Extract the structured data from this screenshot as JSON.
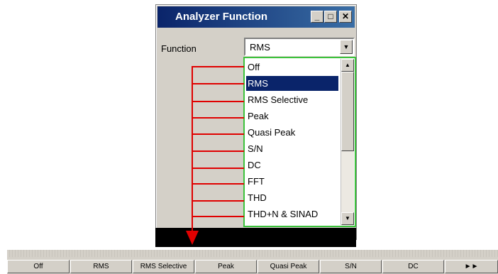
{
  "dialog": {
    "title": "Analyzer Function",
    "title_buttons": {
      "minimize": "_",
      "maximize": "□",
      "close": "✕"
    },
    "function_label": "Function",
    "function_value": "RMS"
  },
  "dropdown": {
    "items": [
      "Off",
      "RMS",
      "RMS Selective",
      "Peak",
      "Quasi Peak",
      "S/N",
      "DC",
      "FFT",
      "THD",
      "THD+N & SINAD"
    ],
    "selected_index": 1,
    "scroll_up": "▲",
    "scroll_down": "▼"
  },
  "softkeys": [
    "Off",
    "RMS",
    "RMS Selective",
    "Peak",
    "Quasi Peak",
    "S/N",
    "DC",
    "►►"
  ],
  "colors": {
    "accent": "#0a246a",
    "arrow": "#e00000",
    "list_border": "#3cc23c"
  }
}
